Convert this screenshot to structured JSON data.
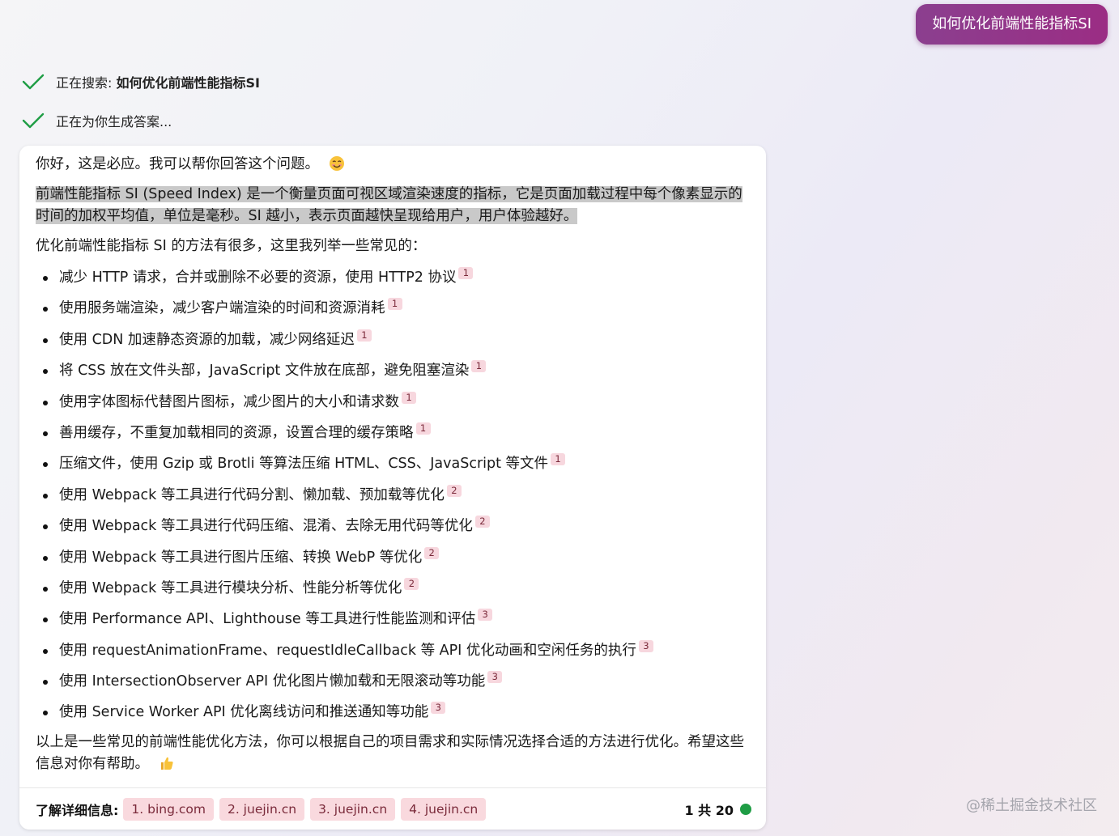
{
  "user_query": "如何优化前端性能指标SI",
  "status": [
    {
      "prefix": "正在搜索:",
      "bold": "如何优化前端性能指标SI"
    },
    {
      "prefix": "正在为你生成答案...",
      "bold": ""
    }
  ],
  "answer": {
    "greeting": "你好，这是必应。我可以帮你回答这个问题。",
    "definition": "前端性能指标 SI (Speed Index) 是一个衡量页面可视区域渲染速度的指标，它是页面加载过程中每个像素显示的时间的加权平均值，单位是毫秒。SI 越小，表示页面越快呈现给用户，用户体验越好。",
    "intro": "优化前端性能指标 SI 的方法有很多，这里我列举一些常见的：",
    "bullets": [
      {
        "text": "减少 HTTP 请求，合并或删除不必要的资源，使用 HTTP2 协议",
        "cite": "1"
      },
      {
        "text": "使用服务端渲染，减少客户端渲染的时间和资源消耗",
        "cite": "1"
      },
      {
        "text": "使用 CDN 加速静态资源的加载，减少网络延迟",
        "cite": "1"
      },
      {
        "text": "将 CSS 放在文件头部，JavaScript 文件放在底部，避免阻塞渲染",
        "cite": "1"
      },
      {
        "text": "使用字体图标代替图片图标，减少图片的大小和请求数",
        "cite": "1"
      },
      {
        "text": "善用缓存，不重复加载相同的资源，设置合理的缓存策略",
        "cite": "1"
      },
      {
        "text": "压缩文件，使用 Gzip 或 Brotli 等算法压缩 HTML、CSS、JavaScript 等文件",
        "cite": "1"
      },
      {
        "text": "使用 Webpack 等工具进行代码分割、懒加载、预加载等优化",
        "cite": "2"
      },
      {
        "text": "使用 Webpack 等工具进行代码压缩、混淆、去除无用代码等优化",
        "cite": "2"
      },
      {
        "text": "使用 Webpack 等工具进行图片压缩、转换 WebP 等优化",
        "cite": "2"
      },
      {
        "text": "使用 Webpack 等工具进行模块分析、性能分析等优化",
        "cite": "2"
      },
      {
        "text": "使用 Performance API、Lighthouse 等工具进行性能监测和评估",
        "cite": "3"
      },
      {
        "text": "使用 requestAnimationFrame、requestIdleCallback 等 API 优化动画和空闲任务的执行",
        "cite": "3"
      },
      {
        "text": "使用 IntersectionObserver API 优化图片懒加载和无限滚动等功能",
        "cite": "3"
      },
      {
        "text": "使用 Service Worker API 优化离线访问和推送通知等功能",
        "cite": "3"
      }
    ],
    "closing": "以上是一些常见的前端性能优化方法，你可以根据自己的项目需求和实际情况选择合适的方法进行优化。希望这些信息对你有帮助。"
  },
  "footer": {
    "label": "了解详细信息:",
    "sources": [
      "1. bing.com",
      "2. juejin.cn",
      "3. juejin.cn",
      "4. juejin.cn"
    ],
    "count": "1 共 20"
  },
  "watermark": "@稀土掘金技术社区",
  "icons": {
    "status": "check-icon",
    "greeting_emoji": "smile-emoji-icon",
    "closing_emoji": "thumbs-up-emoji-icon",
    "turn_indicator": "green-dot-icon"
  },
  "colors": {
    "user_bubble": "#9b2d84",
    "check": "#1f9d45",
    "citation_bg": "#f9d9de",
    "highlight": "#c9c9c9"
  }
}
